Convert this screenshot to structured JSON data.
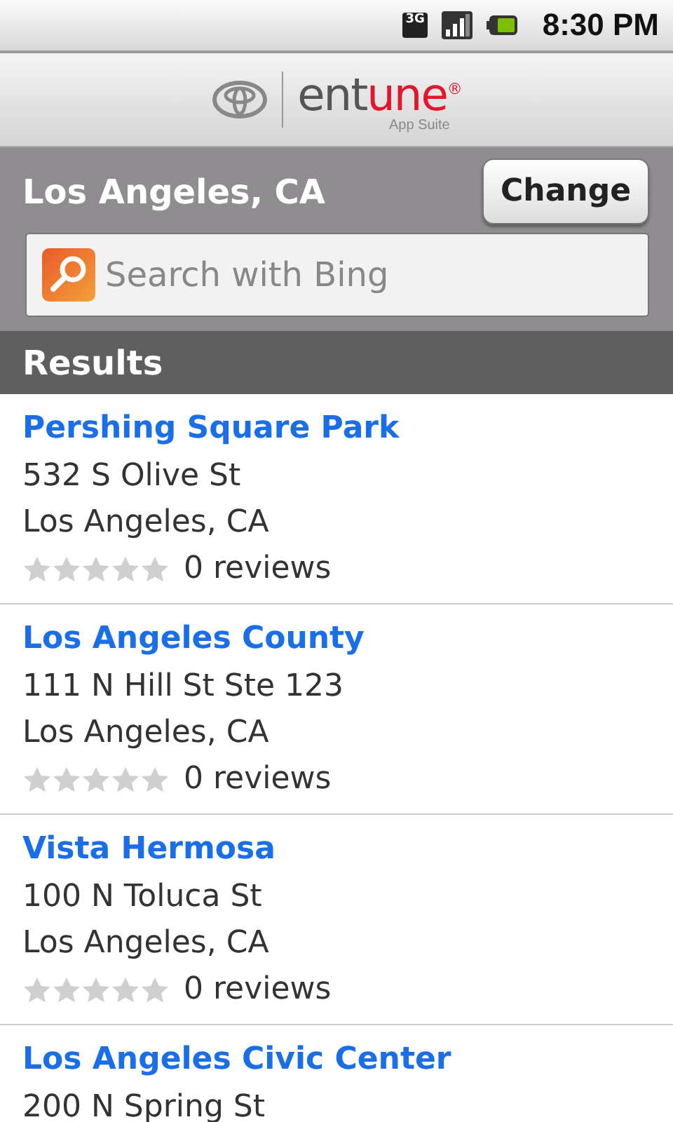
{
  "status_bar": {
    "network": "3G",
    "time": "8:30 PM"
  },
  "header": {
    "logo_dark": "ent",
    "logo_red": "une",
    "logo_mark": "®",
    "tagline": "App Suite"
  },
  "location": {
    "city": "Los Angeles, CA",
    "change_button": "Change"
  },
  "search": {
    "placeholder": "Search with Bing"
  },
  "results_header": "Results",
  "results": [
    {
      "name": "Pershing Square Park",
      "street": "532 S Olive St",
      "city": "Los Angeles, CA",
      "stars": 0,
      "reviews": "0 reviews"
    },
    {
      "name": "Los Angeles County",
      "street": "111 N Hill St Ste 123",
      "city": "Los Angeles, CA",
      "stars": 0,
      "reviews": "0 reviews"
    },
    {
      "name": "Vista Hermosa",
      "street": "100 N Toluca St",
      "city": "Los Angeles, CA",
      "stars": 0,
      "reviews": "0 reviews"
    },
    {
      "name": "Los Angeles Civic Center",
      "street": "200 N Spring St"
    }
  ]
}
